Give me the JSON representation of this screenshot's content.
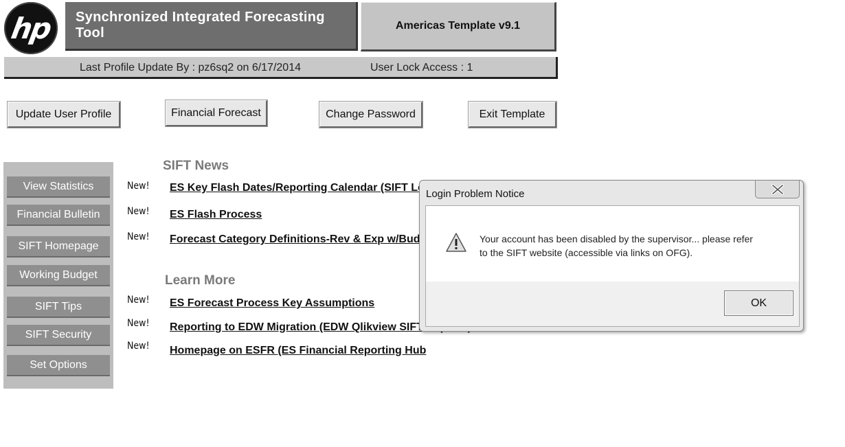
{
  "header": {
    "logo_text": "hp",
    "app_title": "Synchronized Integrated Forecasting Tool",
    "template_version": "Americas  Template  v9.1",
    "profile_update": "Last Profile Update By : pz6sq2  on 6/17/2014",
    "user_lock": "User Lock Access :  1"
  },
  "toolbar": {
    "update_profile": "Update User Profile",
    "financial_forecast": "Financial Forecast",
    "change_password": "Change Password",
    "exit_template": "Exit Template"
  },
  "sidebar": {
    "items": [
      {
        "label": "View Statistics"
      },
      {
        "label": "Financial Bulletin"
      },
      {
        "label": "SIFT Homepage"
      },
      {
        "label": "Working Budget"
      },
      {
        "label": "SIFT Tips"
      },
      {
        "label": "SIFT Security"
      },
      {
        "label": "Set Options"
      }
    ]
  },
  "news": {
    "title": "SIFT News",
    "new_tag": "New!",
    "items": [
      {
        "label": "ES Key Flash Dates/Reporting Calendar  (SIFT Lock Dates)"
      },
      {
        "label": "ES Flash Process"
      },
      {
        "label": "Forecast Category Definitions-Rev  & Exp w/Budget"
      }
    ]
  },
  "learn_more": {
    "title": "Learn More",
    "items": [
      {
        "label": "ES Forecast Process Key Assumptions"
      },
      {
        "label": "Reporting to EDW Migration  (EDW Qlikview  SIFT Reports)"
      },
      {
        "label": "Homepage  on ESFR (ES Financial  Reporting Hub"
      }
    ]
  },
  "dialog": {
    "title": "Login Problem Notice",
    "message_line1": "Your account has been disabled by the supervisor... please refer",
    "message_line2": "to the SIFT website (accessible via links on OFG).",
    "ok_label": "OK",
    "icon": "warning-icon"
  }
}
